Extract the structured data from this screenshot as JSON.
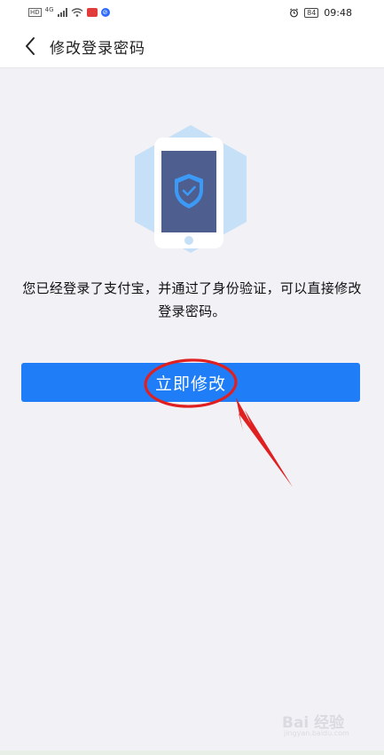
{
  "status_bar": {
    "network_hd": "HD",
    "network_4g": "4G",
    "battery": "84",
    "time": "09:48"
  },
  "header": {
    "title": "修改登录密码"
  },
  "main": {
    "description": "您已经登录了支付宝，并通过了身份验证，可以直接修改登录密码。",
    "button_label": "立即修改"
  },
  "colors": {
    "accent": "#1f7ef7",
    "background": "#f1f1f6",
    "annotation": "#e02020"
  },
  "watermark": {
    "brand": "Bai 经验",
    "sub": "jingyan.baidu.com"
  }
}
